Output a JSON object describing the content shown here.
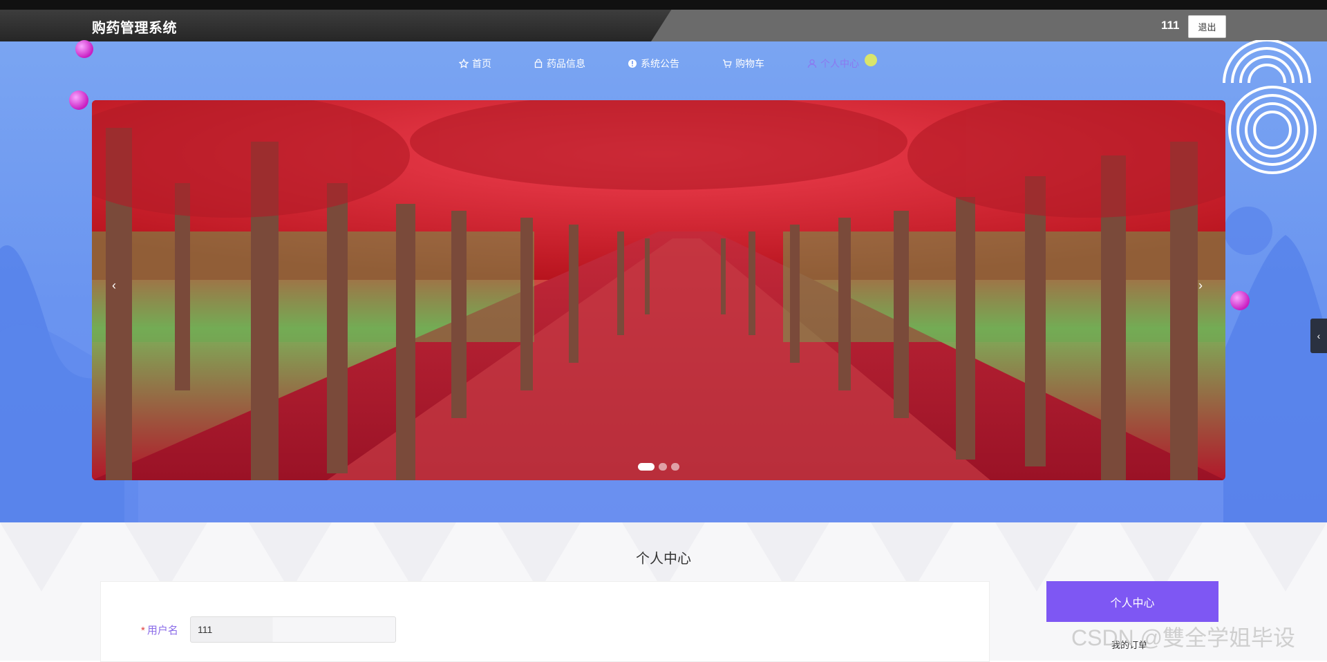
{
  "header": {
    "app_title": "购药管理系统",
    "user_name": "111",
    "logout_label": "退出"
  },
  "nav": {
    "items": [
      {
        "label": "首页",
        "icon": "star-icon"
      },
      {
        "label": "药品信息",
        "icon": "bag-icon"
      },
      {
        "label": "系统公告",
        "icon": "info-icon"
      },
      {
        "label": "购物车",
        "icon": "cart-icon"
      },
      {
        "label": "个人中心",
        "icon": "user-icon",
        "active": true
      }
    ]
  },
  "carousel": {
    "prev_glyph": "‹",
    "next_glyph": "›",
    "slide_count": 3,
    "active_index": 0
  },
  "main": {
    "section_title": "个人中心",
    "form": {
      "username_label": "用户名",
      "required_mark": "*",
      "username_value": "111"
    },
    "side_menu": {
      "active_label": "个人中心",
      "sub_label": "我的订单"
    }
  },
  "watermark": "CSDN @雙全学姐毕设",
  "edge_tab_glyph": "‹",
  "colors": {
    "header_bg": "#2e2e2e",
    "blue_bg": "#6f98f0",
    "accent_purple": "#7e57f3",
    "active_nav": "#8b78f0"
  }
}
